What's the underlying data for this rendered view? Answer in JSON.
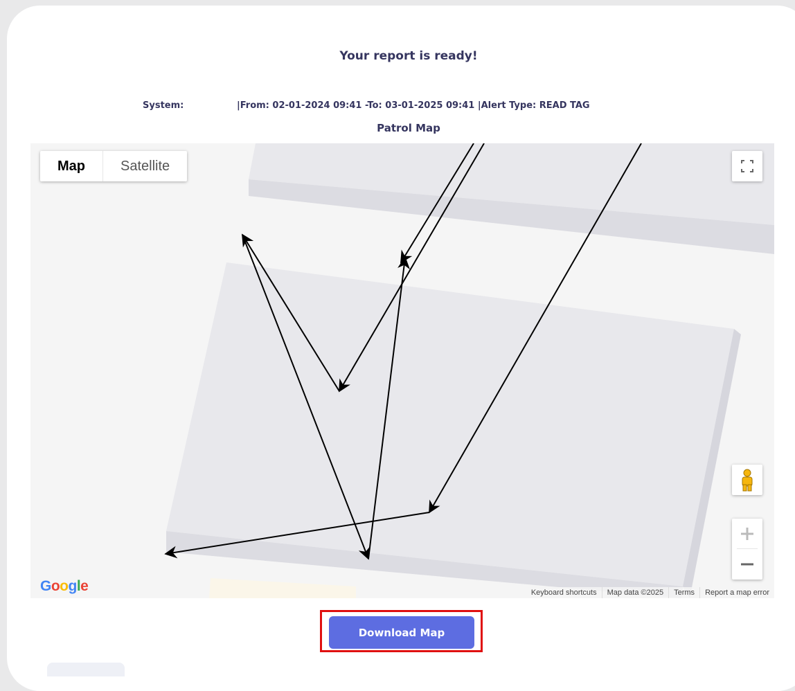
{
  "header": {
    "title": "Your report is ready!",
    "system_label": "System:",
    "range_text": "|From: 02-01-2024 09:41 -To: 03-01-2025 09:41 |Alert Type: READ TAG",
    "subtitle": "Patrol Map"
  },
  "map": {
    "type_buttons": {
      "map": "Map",
      "satellite": "Satellite"
    },
    "active_type": "Map",
    "logo_text": "Google",
    "attribution": {
      "shortcuts": "Keyboard shortcuts",
      "data": "Map data ©2025",
      "terms": "Terms",
      "report": "Report a map error"
    },
    "icons": [
      "fullscreen-icon",
      "pegman-icon",
      "zoom-in-icon",
      "zoom-out-icon"
    ]
  },
  "actions": {
    "download_label": "Download Map"
  },
  "colors": {
    "button_bg": "#5d6de1",
    "highlight_border": "#e01010",
    "heading_text": "#35355f"
  }
}
